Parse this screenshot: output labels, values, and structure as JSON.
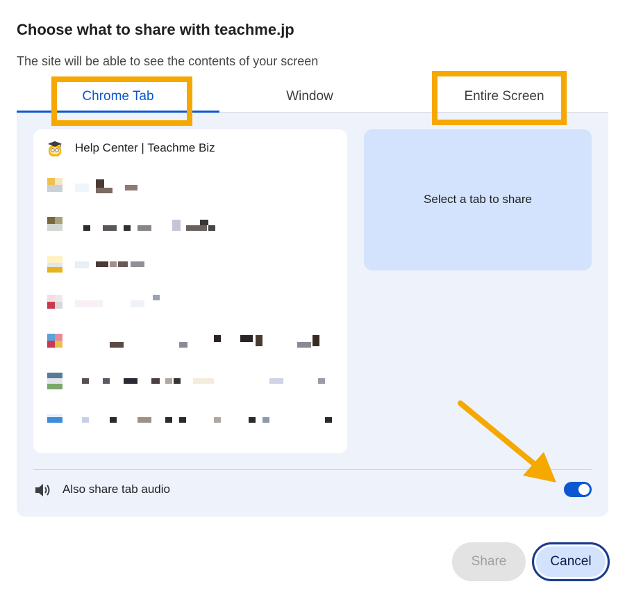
{
  "dialog": {
    "title": "Choose what to share with teachme.jp",
    "subtitle": "The site will be able to see the contents of your screen"
  },
  "tabs": [
    {
      "label": "Chrome Tab",
      "active": true
    },
    {
      "label": "Window",
      "active": false
    },
    {
      "label": "Entire Screen",
      "active": false
    }
  ],
  "tab_list": {
    "items": [
      {
        "label": "Help Center | Teachme Biz",
        "icon": "teachme-owl-icon"
      },
      {
        "label": "",
        "icon": "favicon",
        "obscured": true
      },
      {
        "label": "",
        "icon": "favicon",
        "obscured": true
      },
      {
        "label": "",
        "icon": "favicon",
        "obscured": true
      },
      {
        "label": "",
        "icon": "favicon",
        "obscured": true
      },
      {
        "label": "",
        "icon": "favicon",
        "obscured": true
      },
      {
        "label": "",
        "icon": "favicon",
        "obscured": true
      },
      {
        "label": "",
        "icon": "favicon",
        "obscured": true
      }
    ]
  },
  "preview": {
    "message": "Select a tab to share"
  },
  "audio": {
    "label": "Also share tab audio",
    "enabled": true,
    "icon": "speaker-icon"
  },
  "buttons": {
    "share": "Share",
    "cancel": "Cancel"
  },
  "colors": {
    "accent": "#0b57d0",
    "highlight": "#f5a800",
    "panel": "#eef2fa",
    "preview": "#d3e3fd"
  }
}
